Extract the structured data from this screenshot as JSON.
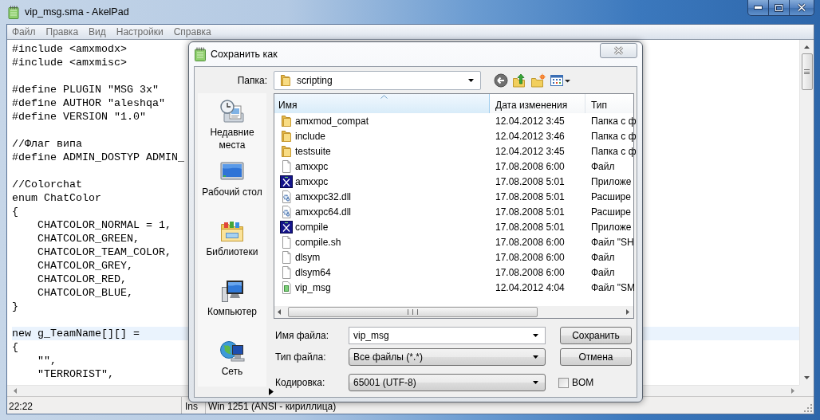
{
  "window": {
    "title": "vip_msg.sma - AkelPad"
  },
  "menu": [
    "Файл",
    "Правка",
    "Вид",
    "Настройки",
    "Справка"
  ],
  "editor": {
    "blocks": [
      [
        {
          "text": "#include <amxmodx>",
          "current": false
        },
        {
          "text": "#include <amxmisc>",
          "current": false
        }
      ],
      [
        {
          "text": "#define PLUGIN \"MSG 3x\"",
          "current": false
        },
        {
          "text": "#define AUTHOR \"aleshqa\"",
          "current": false
        },
        {
          "text": "#define VERSION \"1.0\"",
          "current": false
        }
      ],
      [
        {
          "text": "//Флаг випа",
          "current": false
        },
        {
          "text": "#define ADMIN_DOSTYP ADMIN_",
          "current": false
        }
      ],
      [
        {
          "text": "//Colorchat",
          "current": false
        },
        {
          "text": "enum ChatColor",
          "current": false
        },
        {
          "text": "{",
          "current": false
        },
        {
          "text": "    CHATCOLOR_NORMAL = 1,",
          "current": false
        },
        {
          "text": "    CHATCOLOR_GREEN,",
          "current": false
        },
        {
          "text": "    CHATCOLOR_TEAM_COLOR,",
          "current": false
        },
        {
          "text": "    CHATCOLOR_GREY,",
          "current": false
        },
        {
          "text": "    CHATCOLOR_RED,",
          "current": false
        },
        {
          "text": "    CHATCOLOR_BLUE,",
          "current": false
        },
        {
          "text": "}",
          "current": false
        }
      ],
      [
        {
          "text": "new g_TeamName[][] =",
          "current": true
        },
        {
          "text": "{",
          "current": false
        },
        {
          "text": "    \"\",",
          "current": false
        },
        {
          "text": "    \"TERRORIST\",",
          "current": false
        }
      ]
    ]
  },
  "status_bar": {
    "position": "22:22",
    "mode": "Ins",
    "encoding": "Win 1251 (ANSI - кириллица)"
  },
  "dialog": {
    "title": "Сохранить как",
    "folder_label": "Папка:",
    "folder": "scripting",
    "places": [
      {
        "label": "Недавние\nместа",
        "kind": "recent"
      },
      {
        "label": "Рабочий стол",
        "kind": "desktop"
      },
      {
        "label": "Библиотеки",
        "kind": "libraries"
      },
      {
        "label": "Компьютер",
        "kind": "computer"
      },
      {
        "label": "Сеть",
        "kind": "network"
      }
    ],
    "columns": [
      {
        "label": "Имя",
        "sorted": true
      },
      {
        "label": "Дата изменения",
        "sorted": false
      },
      {
        "label": "Тип",
        "sorted": false
      }
    ],
    "files": [
      {
        "name": "amxmod_compat",
        "date": "12.04.2012 3:45",
        "type": "Папка с ф",
        "kind": "folder"
      },
      {
        "name": "include",
        "date": "12.04.2012 3:46",
        "type": "Папка с ф",
        "kind": "folder"
      },
      {
        "name": "testsuite",
        "date": "12.04.2012 3:45",
        "type": "Папка с ф",
        "kind": "folder"
      },
      {
        "name": "amxxpc",
        "date": "17.08.2008 6:00",
        "type": "Файл",
        "kind": "file"
      },
      {
        "name": "amxxpc",
        "date": "17.08.2008 5:01",
        "type": "Приложе",
        "kind": "app"
      },
      {
        "name": "amxxpc32.dll",
        "date": "17.08.2008 5:01",
        "type": "Расшире",
        "kind": "dll"
      },
      {
        "name": "amxxpc64.dll",
        "date": "17.08.2008 5:01",
        "type": "Расшире",
        "kind": "dll"
      },
      {
        "name": "compile",
        "date": "17.08.2008 5:01",
        "type": "Приложе",
        "kind": "app"
      },
      {
        "name": "compile.sh",
        "date": "17.08.2008 6:00",
        "type": "Файл \"SH",
        "kind": "file"
      },
      {
        "name": "dlsym",
        "date": "17.08.2008 6:00",
        "type": "Файл",
        "kind": "file"
      },
      {
        "name": "dlsym64",
        "date": "17.08.2008 6:00",
        "type": "Файл",
        "kind": "file"
      },
      {
        "name": "vip_msg",
        "date": "12.04.2012 4:04",
        "type": "Файл \"SM",
        "kind": "sma"
      }
    ],
    "filename": {
      "label": "Имя файла:",
      "value": "vip_msg"
    },
    "filetype": {
      "label": "Тип файла:",
      "value": "Все файлы (*.*)"
    },
    "encoding": {
      "label": "Кодировка:",
      "value": "65001 (UTF-8)"
    },
    "bom": {
      "label": "BOM",
      "checked": false
    },
    "buttons": [
      "Сохранить",
      "Отмена"
    ]
  }
}
